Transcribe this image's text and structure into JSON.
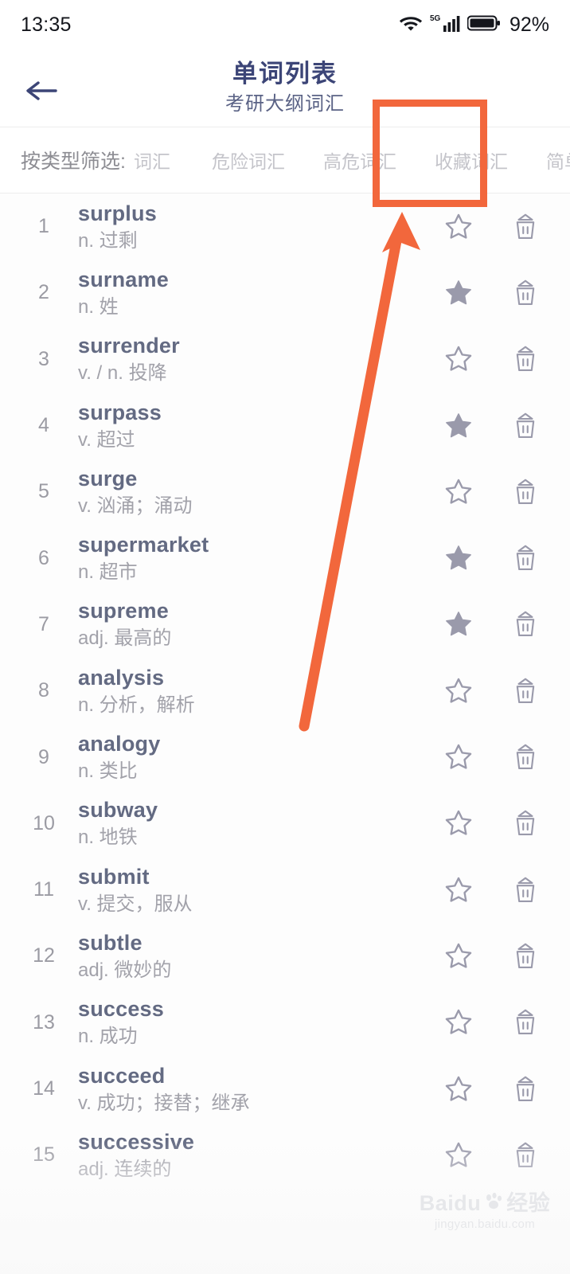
{
  "status_bar": {
    "time": "13:35",
    "network_label": "5G",
    "battery_percent": "92%"
  },
  "header": {
    "back_label": "←",
    "title": "单词列表",
    "subtitle": "考研大纲词汇"
  },
  "filter": {
    "label": "按类型筛选:",
    "options": [
      "词汇",
      "危险词汇",
      "高危词汇",
      "收藏词汇",
      "简单词"
    ],
    "highlighted_option": "收藏词汇"
  },
  "colors": {
    "title": "#3c4577",
    "subtitle": "#5a6285",
    "word": "#636a82",
    "definition": "#a2a2aa",
    "index": "#9b9ba3",
    "filter_chip": "#c4c4ca",
    "annotation": "#f2673c",
    "star": "#9a9aab"
  },
  "words": [
    {
      "index": "1",
      "word": "surplus",
      "definition": "n. 过剩",
      "starred": false
    },
    {
      "index": "2",
      "word": "surname",
      "definition": "n. 姓",
      "starred": true
    },
    {
      "index": "3",
      "word": "surrender",
      "definition": "v. / n. 投降",
      "starred": false
    },
    {
      "index": "4",
      "word": "surpass",
      "definition": "v. 超过",
      "starred": true
    },
    {
      "index": "5",
      "word": "surge",
      "definition": "v. 汹涌；涌动",
      "starred": false
    },
    {
      "index": "6",
      "word": "supermarket",
      "definition": "n. 超市",
      "starred": true
    },
    {
      "index": "7",
      "word": "supreme",
      "definition": "adj. 最高的",
      "starred": true
    },
    {
      "index": "8",
      "word": "analysis",
      "definition": "n. 分析，解析",
      "starred": false
    },
    {
      "index": "9",
      "word": "analogy",
      "definition": "n. 类比",
      "starred": false
    },
    {
      "index": "10",
      "word": "subway",
      "definition": "n. 地铁",
      "starred": false
    },
    {
      "index": "11",
      "word": "submit",
      "definition": "v. 提交，服从",
      "starred": false
    },
    {
      "index": "12",
      "word": "subtle",
      "definition": "adj. 微妙的",
      "starred": false
    },
    {
      "index": "13",
      "word": "success",
      "definition": "n. 成功",
      "starred": false
    },
    {
      "index": "14",
      "word": "succeed",
      "definition": "v. 成功；接替；继承",
      "starred": false
    },
    {
      "index": "15",
      "word": "successive",
      "definition": "adj. 连续的",
      "starred": false
    }
  ],
  "watermark": {
    "brand": "Baidu",
    "brand_cn": "经验",
    "url": "jingyan.baidu.com"
  }
}
